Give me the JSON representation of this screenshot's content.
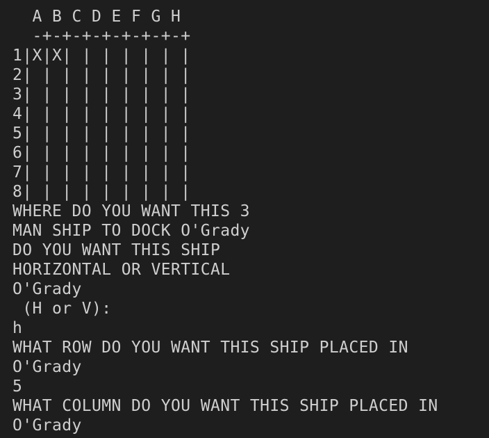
{
  "terminal": {
    "lines": [
      "  A B C D E F G H",
      "  -+-+-+-+-+-+-+-+",
      "1|X|X| | | | | | |",
      "2| | | | | | | | |",
      "3| | | | | | | | |",
      "4| | | | | | | | |",
      "5| | | | | | | | |",
      "6| | | | | | | | |",
      "7| | | | | | | | |",
      "8| | | | | | | | |",
      "WHERE DO YOU WANT THIS 3",
      "MAN SHIP TO DOCK O'Grady",
      "DO YOU WANT THIS SHIP",
      "HORIZONTAL OR VERTICAL",
      "O'Grady",
      " (H or V):",
      "h",
      "WHAT ROW DO YOU WANT THIS SHIP PLACED IN",
      "O'Grady",
      "5",
      "WHAT COLUMN DO YOU WANT THIS SHIP PLACED IN",
      "O'Grady"
    ]
  }
}
